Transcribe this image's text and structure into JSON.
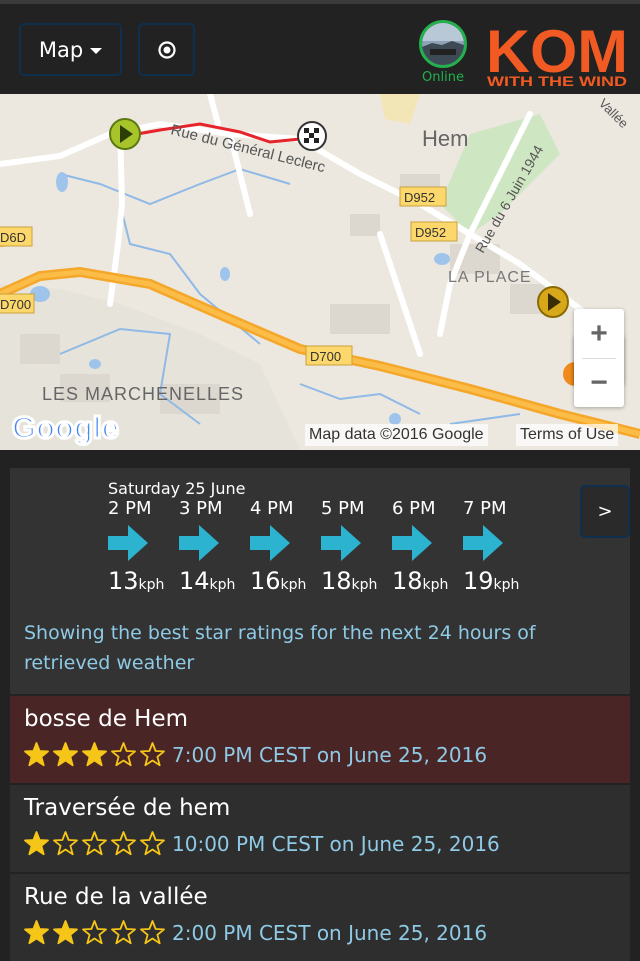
{
  "header": {
    "map_button_label": "Map",
    "status_label": "Online",
    "logo_top": "KOM",
    "logo_bottom": "WITH THE WIND"
  },
  "map": {
    "labels": {
      "street_general": "Rue du Général Leclerc",
      "hem": "Hem",
      "d952a": "D952",
      "d952b": "D952",
      "d6d": "D6D",
      "d700a": "D700",
      "d700b": "D700",
      "rue_6_juin": "Rue du 6 Juin 1944",
      "la_place": "LA PLACE",
      "marchenelles": "LES MARCHENELLES",
      "vallee": "Vallée"
    },
    "google_logo": "Google",
    "attribution": "Map data ©2016 Google",
    "terms": "Terms of Use",
    "zoom_in": "+",
    "zoom_out": "−"
  },
  "forecast": {
    "day": "Saturday 25 June",
    "next_label": ">",
    "unit": "kph",
    "hours": [
      {
        "time": "2 PM",
        "speed": "13"
      },
      {
        "time": "3 PM",
        "speed": "14"
      },
      {
        "time": "4 PM",
        "speed": "16"
      },
      {
        "time": "5 PM",
        "speed": "18"
      },
      {
        "time": "6 PM",
        "speed": "18"
      },
      {
        "time": "7 PM",
        "speed": "19"
      }
    ],
    "info": "Showing the best star ratings for the next 24 hours of retrieved weather"
  },
  "segments": [
    {
      "name": "bosse de Hem",
      "stars": 3,
      "when": "7:00 PM CEST on June 25, 2016",
      "selected": true
    },
    {
      "name": "Traversée de hem",
      "stars": 1,
      "when": "10:00 PM CEST on June 25, 2016",
      "selected": false
    },
    {
      "name": "Rue de la vallée",
      "stars": 2,
      "when": "2:00 PM CEST on June 25, 2016",
      "selected": false
    }
  ],
  "colors": {
    "accent_text": "#8ecae6",
    "online": "#22b14c",
    "logo_orange": "#f15a22",
    "arrow": "#2bb3cf",
    "selected_row": "#4a2525",
    "row": "#2e2e2e",
    "star": "#f5c518"
  }
}
